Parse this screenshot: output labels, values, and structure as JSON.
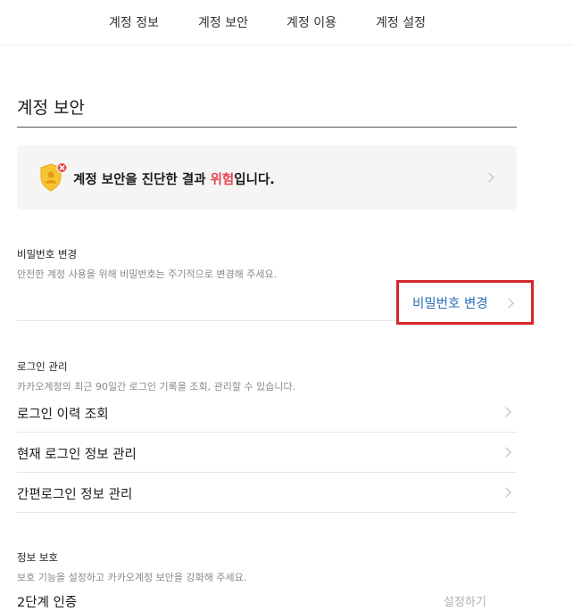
{
  "nav": {
    "tabs": [
      "계정 정보",
      "계정 보안",
      "계정 이용",
      "계정 설정"
    ]
  },
  "page": {
    "title": "계정 보안"
  },
  "diagnosis": {
    "prefix": "계정 보안을 진단한 결과 ",
    "status": "위험",
    "suffix": "입니다.",
    "status_color": "#e5464c",
    "icon": "shield-warning-icon"
  },
  "password": {
    "title": "비밀번호 변경",
    "description": "안전한 계정 사용을 위해 비밀번호는 주기적으로 변경해 주세요.",
    "action_label": "비밀번호 변경",
    "action_color": "#2d6fb4"
  },
  "login": {
    "title": "로그인 관리",
    "description": "카카오계정의 최근 90일간 로그인 기록을 조회, 관리할 수 있습니다.",
    "items": [
      "로그인 이력 조회",
      "현재 로그인 정보 관리",
      "간편로그인 정보 관리"
    ]
  },
  "protection": {
    "title": "정보 보호",
    "description": "보호 기능을 설정하고 카카오계정 보안을 강화해 주세요.",
    "first_item": "2단계 인증",
    "first_item_status": "설정하기"
  },
  "colors": {
    "highlight_border": "#d6262e"
  }
}
